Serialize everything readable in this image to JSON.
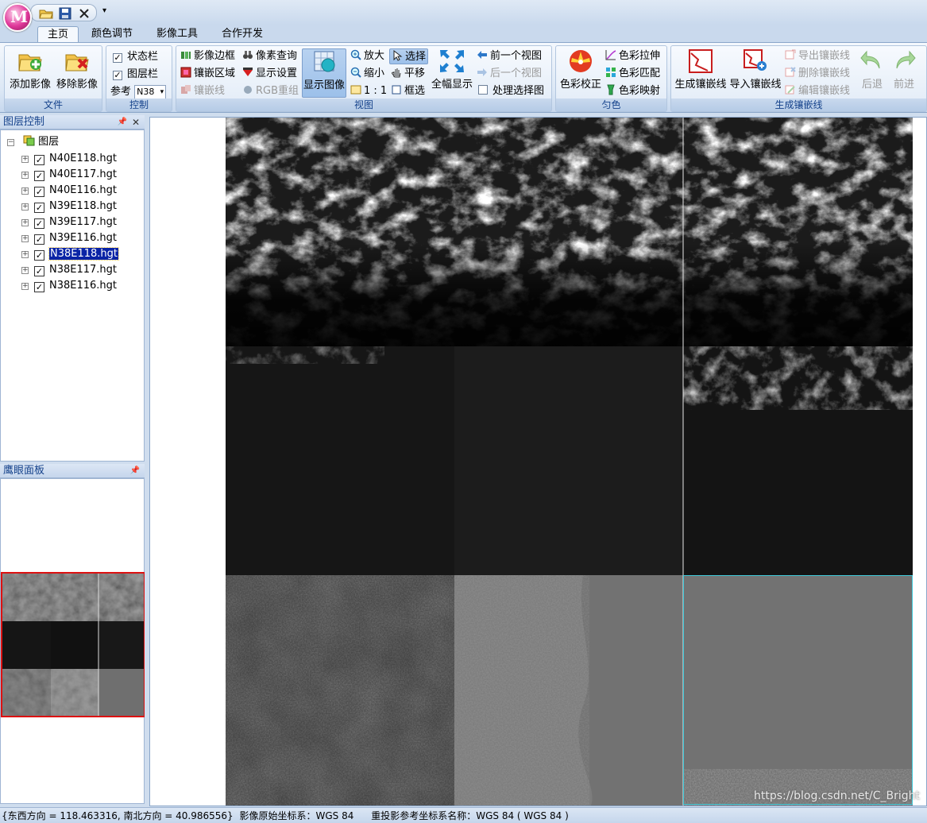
{
  "app": {
    "orb_letter": "M",
    "quick_access": [
      "folder-open-icon",
      "save-icon",
      "close-icon"
    ],
    "quick_access_dropdown": "▾"
  },
  "tabs": [
    "主页",
    "颜色调节",
    "影像工具",
    "合作开发"
  ],
  "active_tab": "主页",
  "ribbon": {
    "file": {
      "label": "文件",
      "add": "添加影像",
      "remove": "移除影像"
    },
    "control": {
      "label": "控制",
      "status_bar": "状态栏",
      "layer_bar": "图层栏",
      "ref_label": "参考",
      "ref_value": "N38"
    },
    "view": {
      "label": "视图",
      "image_border": "影像边框",
      "pixel_query": "像素查询",
      "mosaic_area": "镶嵌区域",
      "display_settings": "显示设置",
      "seam_line": "镶嵌线",
      "rgb_regroup": "RGB重组",
      "show_image": "显示图像",
      "zoom_in": "放大",
      "select": "选择",
      "zoom_out": "缩小",
      "pan": "平移",
      "one_to_one": "1 : 1",
      "box_select": "框选",
      "full_extent": "全幅显示",
      "prev_view": "前一个视图",
      "next_view": "后一个视图",
      "process_selected": "处理选择图"
    },
    "color": {
      "label": "匀色",
      "correction": "色彩校正",
      "stretch": "色彩拉伸",
      "match": "色彩匹配",
      "mapping": "色彩映射"
    },
    "seamline": {
      "label": "生成镶嵌线",
      "generate": "生成镶嵌线",
      "import": "导入镶嵌线",
      "export": "导出镶嵌线",
      "delete": "删除镶嵌线",
      "edit": "编辑镶嵌线",
      "undo": "后退",
      "redo": "前进"
    }
  },
  "layer_panel": {
    "title": "图层控制",
    "root": "图层",
    "layers": [
      {
        "name": "N40E118.hgt",
        "checked": true,
        "selected": false
      },
      {
        "name": "N40E117.hgt",
        "checked": true,
        "selected": false
      },
      {
        "name": "N40E116.hgt",
        "checked": true,
        "selected": false
      },
      {
        "name": "N39E118.hgt",
        "checked": true,
        "selected": false
      },
      {
        "name": "N39E117.hgt",
        "checked": true,
        "selected": false
      },
      {
        "name": "N39E116.hgt",
        "checked": true,
        "selected": false
      },
      {
        "name": "N38E118.hgt",
        "checked": true,
        "selected": true
      },
      {
        "name": "N38E117.hgt",
        "checked": true,
        "selected": false
      },
      {
        "name": "N38E116.hgt",
        "checked": true,
        "selected": false
      }
    ]
  },
  "overview_panel": {
    "title": "鹰眼面板"
  },
  "status": {
    "coords": "{东西方向 = 118.463316,  南北方向 = 40.986556}",
    "orig_crs": "影像原始坐标系：WGS 84",
    "reproj_crs": "重投影参考坐标系名称：WGS 84 ( WGS 84 )"
  },
  "watermark": "https://blog.csdn.net/C_Bright",
  "colors": {
    "accent": "#15428b",
    "selection": "#0a24a6",
    "overview_border": "#dd1111",
    "selected_tile_border": "#3ec8d8"
  }
}
